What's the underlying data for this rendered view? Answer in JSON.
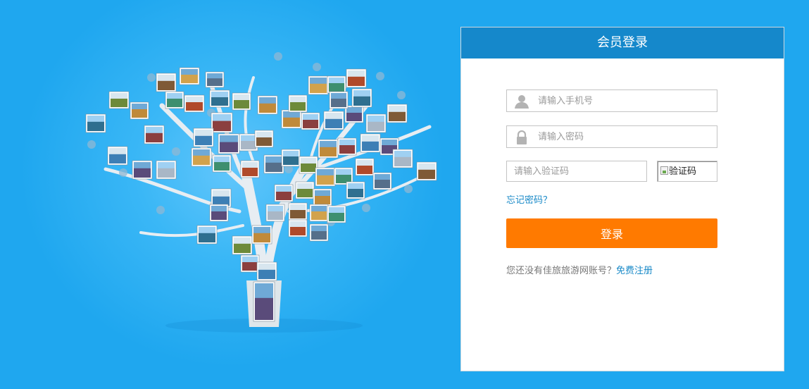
{
  "login": {
    "title": "会员登录",
    "phone_placeholder": "请输入手机号",
    "password_placeholder": "请输入密码",
    "captcha_placeholder": "请输入验证码",
    "captcha_alt": "验证码",
    "forgot_label": "忘记密码？",
    "submit_label": "登录",
    "register_prompt": "您还没有佳旅旅游网账号？",
    "register_link": "免费注册"
  },
  "icons": {
    "phone_field": "user-icon",
    "password_field": "lock-icon",
    "captcha_image": "broken-image-icon"
  },
  "colors": {
    "page_background": "#1fa7ef",
    "header": "#1588cb",
    "login_button": "#ff7a00",
    "link": "#1a8ac8"
  }
}
